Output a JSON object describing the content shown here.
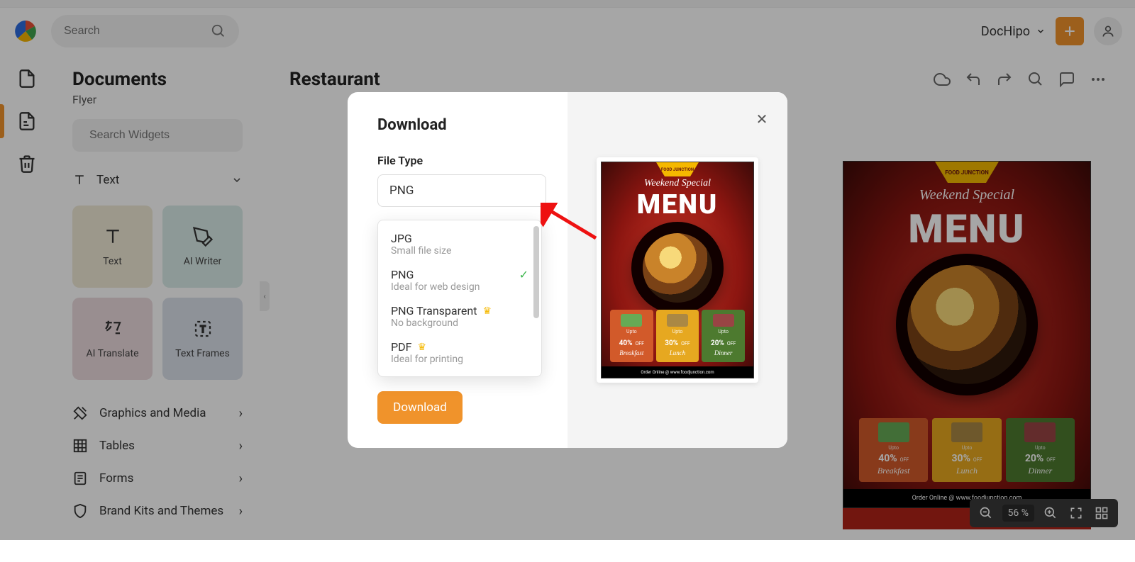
{
  "header": {
    "search_placeholder": "Search",
    "workspace": "DocHipo"
  },
  "sidebar": {
    "title": "Documents",
    "subtitle": "Flyer",
    "widget_search_placeholder": "Search Widgets",
    "text_row": "Text",
    "tiles": {
      "text": "Text",
      "ai_writer": "AI Writer",
      "ai_translate": "AI Translate",
      "text_frames": "Text Frames"
    },
    "cats": {
      "graphics": "Graphics and Media",
      "tables": "Tables",
      "forms": "Forms",
      "brand": "Brand Kits and Themes"
    }
  },
  "document": {
    "title": "Restaurant"
  },
  "modal": {
    "title": "Download",
    "file_type_label": "File Type",
    "selected": "PNG",
    "options": {
      "jpg": {
        "title": "JPG",
        "desc": "Small file size"
      },
      "png": {
        "title": "PNG",
        "desc": "Ideal for web design"
      },
      "png_t": {
        "title": "PNG Transparent",
        "desc": "No background"
      },
      "pdf": {
        "title": "PDF",
        "desc": "Ideal for printing"
      }
    },
    "download_btn": "Download"
  },
  "flyer": {
    "badge": "FOOD JUNCTION",
    "subhead": "Weekend Special",
    "title": "MENU",
    "deals": [
      {
        "upto": "Upto",
        "pct": "40%",
        "off": "OFF",
        "meal": "Breakfast"
      },
      {
        "upto": "Upto",
        "pct": "30%",
        "off": "OFF",
        "meal": "Lunch"
      },
      {
        "upto": "Upto",
        "pct": "20%",
        "off": "OFF",
        "meal": "Dinner"
      }
    ],
    "url": "Order Online @ www.foodjunction.com"
  },
  "zoom": {
    "value": "56 %"
  }
}
